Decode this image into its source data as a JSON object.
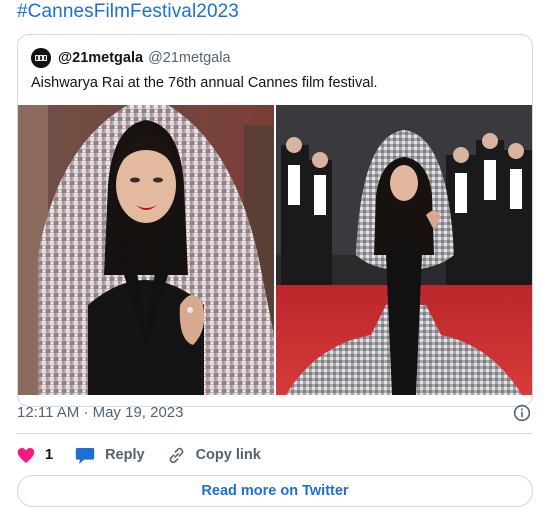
{
  "hashtag": "#CannesFilmFestival2023",
  "quote": {
    "handle_bold": "@21metgala",
    "handle": "@21metgala",
    "text": "Aishwarya Rai at the 76th annual Cannes film festival."
  },
  "meta": {
    "timestamp": "12:11 AM · May 19, 2023"
  },
  "actions": {
    "like_count": "1",
    "reply_label": "Reply",
    "copy_label": "Copy link"
  },
  "read_more_label": "Read more on Twitter",
  "icons": {
    "like": "heart-icon",
    "reply": "speech-bubble-icon",
    "copy": "link-icon",
    "info": "info-icon"
  },
  "colors": {
    "accent": "#1d6fd8",
    "like": "#f91880",
    "muted": "#536471",
    "border": "#cfd9de"
  }
}
